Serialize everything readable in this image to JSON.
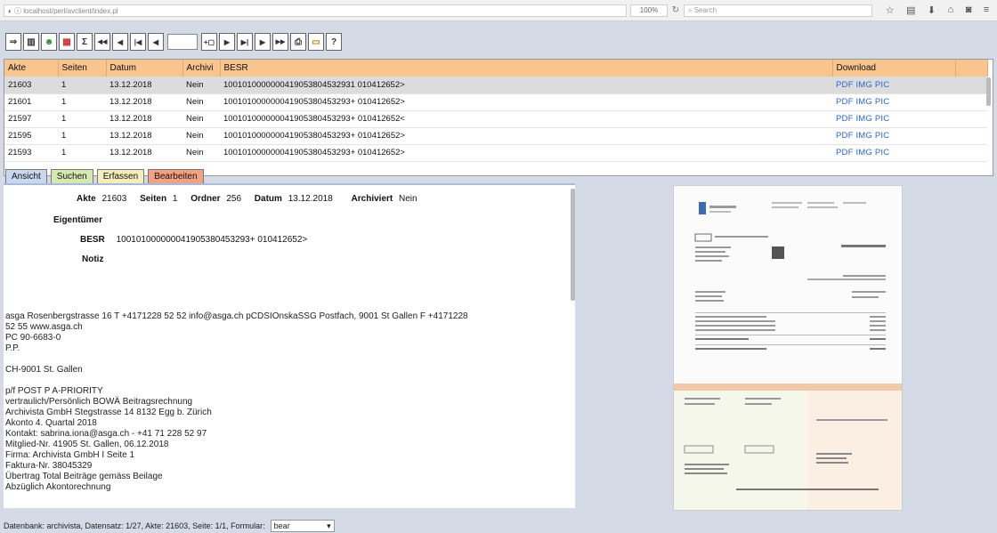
{
  "browser": {
    "url": "localhost/perl/avclient/index.pl",
    "zoom": "100%",
    "reload_icon": "↻",
    "search_placeholder": "Search",
    "icons": [
      "star-icon",
      "reader-icon",
      "download-icon",
      "home-icon",
      "pocket-icon",
      "menu-icon"
    ],
    "icon_glyphs": [
      "☆",
      "▤",
      "⬇",
      "⌂",
      "◙",
      "≡"
    ]
  },
  "toolbar": {
    "buttons": [
      {
        "name": "new-record-button",
        "glyph": "⇒"
      },
      {
        "name": "view-layout-button",
        "glyph": "▥"
      },
      {
        "name": "user-button",
        "glyph": "☻"
      },
      {
        "name": "document-button",
        "glyph": "▦"
      },
      {
        "name": "sum-button",
        "glyph": "Σ"
      },
      {
        "name": "first-button",
        "glyph": "◀◀"
      },
      {
        "name": "prev-button",
        "glyph": "◀"
      },
      {
        "name": "first-page-button",
        "glyph": "|◀"
      },
      {
        "name": "prev-page-button",
        "glyph": "◀"
      }
    ],
    "page_value": "",
    "buttons_right": [
      {
        "name": "add-page-button",
        "glyph": "+▢"
      },
      {
        "name": "next-page-button",
        "glyph": "▶"
      },
      {
        "name": "last-page-button",
        "glyph": "▶|"
      },
      {
        "name": "next-button",
        "glyph": "▶"
      },
      {
        "name": "last-button",
        "glyph": "▶▶"
      },
      {
        "name": "print-button",
        "glyph": "⎙"
      },
      {
        "name": "open-folder-button",
        "glyph": "▭"
      },
      {
        "name": "help-button",
        "glyph": "?"
      }
    ]
  },
  "grid": {
    "columns": [
      "Akte",
      "Seiten",
      "Datum",
      "Archivi",
      "BESR",
      "Download"
    ],
    "rows": [
      {
        "akte": "21603",
        "seiten": "1",
        "datum": "13.12.2018",
        "archiv": "Nein",
        "besr": "1001010000000419053804532931 010412652>",
        "download": "PDF IMG PIC"
      },
      {
        "akte": "21601",
        "seiten": "1",
        "datum": "13.12.2018",
        "archiv": "Nein",
        "besr": "100101000000041905380453293+ 010412652>",
        "download": "PDF IMG PIC"
      },
      {
        "akte": "21597",
        "seiten": "1",
        "datum": "13.12.2018",
        "archiv": "Nein",
        "besr": "100101000000041905380453293+ 010412652<",
        "download": "PDF IMG PIC"
      },
      {
        "akte": "21595",
        "seiten": "1",
        "datum": "13.12.2018",
        "archiv": "Nein",
        "besr": "100101000000041905380453293+ 010412652>",
        "download": "PDF IMG PIC"
      },
      {
        "akte": "21593",
        "seiten": "1",
        "datum": "13.12.2018",
        "archiv": "Nein",
        "besr": "100101000000041905380453293+ 010412652>",
        "download": "PDF IMG PIC"
      }
    ]
  },
  "tabs": {
    "ansicht": "Ansicht",
    "suchen": "Suchen",
    "erfassen": "Erfassen",
    "bearbeiten": "Bearbeiten"
  },
  "detail": {
    "akte_label": "Akte",
    "akte_value": "21603",
    "seiten_label": "Seiten",
    "seiten_value": "1",
    "ordner_label": "Ordner",
    "ordner_value": "256",
    "datum_label": "Datum",
    "datum_value": "13.12.2018",
    "archiviert_label": "Archiviert",
    "archiviert_value": "Nein",
    "eigentuemer_label": "Eigentümer",
    "besr_label": "BESR",
    "besr_value": "100101000000041905380453293+ 010412652>",
    "notiz_label": "Notiz"
  },
  "ocr_lines": [
    "asga Rosenbergstrasse 16 T +4171228 52 52 info@asga.ch pCDSIOnskaSSG Postfach, 9001 St Gallen F +4171228",
    "52 55 www.asga.ch",
    "PC 90-6683-0",
    "P.P.",
    "",
    "CH-9001 St. Gallen",
    "",
    "p/f POST P A-PRIORITY",
    "vertraulich/Persönlich BOWÄ Beitragsrechnung",
    "Archivista GmbH Stegstrasse 14 8132 Egg b. Zürich",
    "Akonto 4. Quartal 2018",
    "Kontakt: sabrina.iona@asga.ch - +41 71 228 52 97",
    "Mitglied-Nr. 41905 St. Gallen, 06.12.2018",
    "Firma: Archivista GmbH I Seite 1",
    "Faktura-Nr. 38045329",
    "Übertrag Total Beiträge gemäss Beilage",
    "Abzüglich Akontorechnung"
  ],
  "status": {
    "text": "Datenbank: archivista, Datensatz: 1/27, Akte: 21603, Seite: 1/1, Formular:",
    "form_value": "bear"
  },
  "colors": {
    "header": "#f9c58e",
    "app_bg": "#d4dbe6",
    "link": "#2a66d0"
  }
}
